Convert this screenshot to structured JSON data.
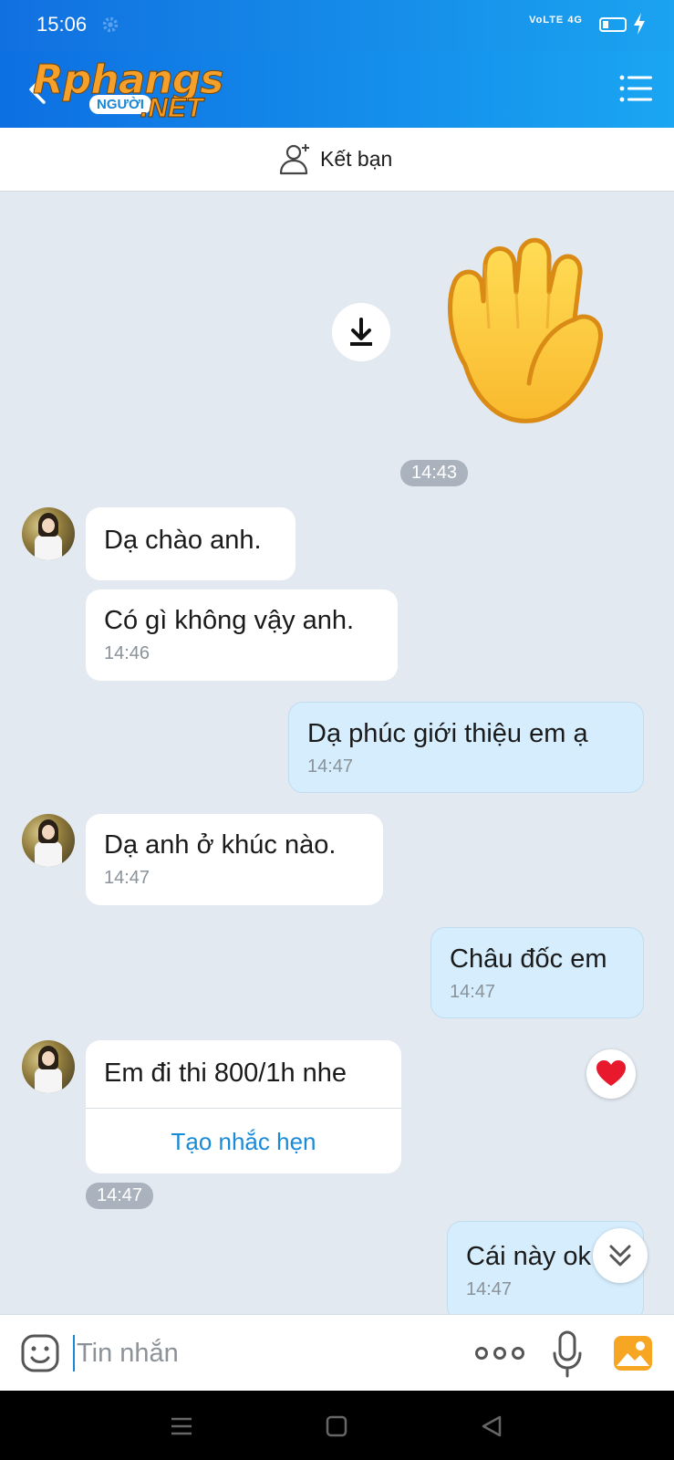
{
  "status_bar": {
    "time": "15:06",
    "network": "VoLTE 4G"
  },
  "header": {
    "logo_brand_a": "Rphang",
    "logo_brand_b": "s",
    "logo_pill": "NGƯỜI",
    "logo_net": ".NET"
  },
  "friend_bar": {
    "label": "Kết bạn"
  },
  "chat": {
    "time_separator": "14:43",
    "messages": [
      {
        "side": "in",
        "text": "Dạ chào anh.",
        "time": ""
      },
      {
        "side": "in",
        "text": "Có gì không vậy anh.",
        "time": "14:46"
      },
      {
        "side": "out",
        "text": "Dạ  phúc giới thiệu em ạ",
        "time": "14:47"
      },
      {
        "side": "in",
        "text": "Dạ anh ở khúc nào.",
        "time": "14:47"
      },
      {
        "side": "out",
        "text": "Châu đốc em",
        "time": "14:47"
      },
      {
        "side": "in",
        "text": "Em đi thi 800/1h nhe",
        "time": "14:47",
        "action": "Tạo nhắc hẹn"
      },
      {
        "side": "out",
        "text": "Cái này ok",
        "time": "14:47"
      }
    ]
  },
  "input_bar": {
    "placeholder": "Tin nhắn"
  },
  "colors": {
    "header_start": "#0d6fe2",
    "header_end": "#1aa6f2",
    "chat_bg": "#e2e9f1",
    "out_bubble": "#d5edfd",
    "link": "#1a8ad6"
  }
}
